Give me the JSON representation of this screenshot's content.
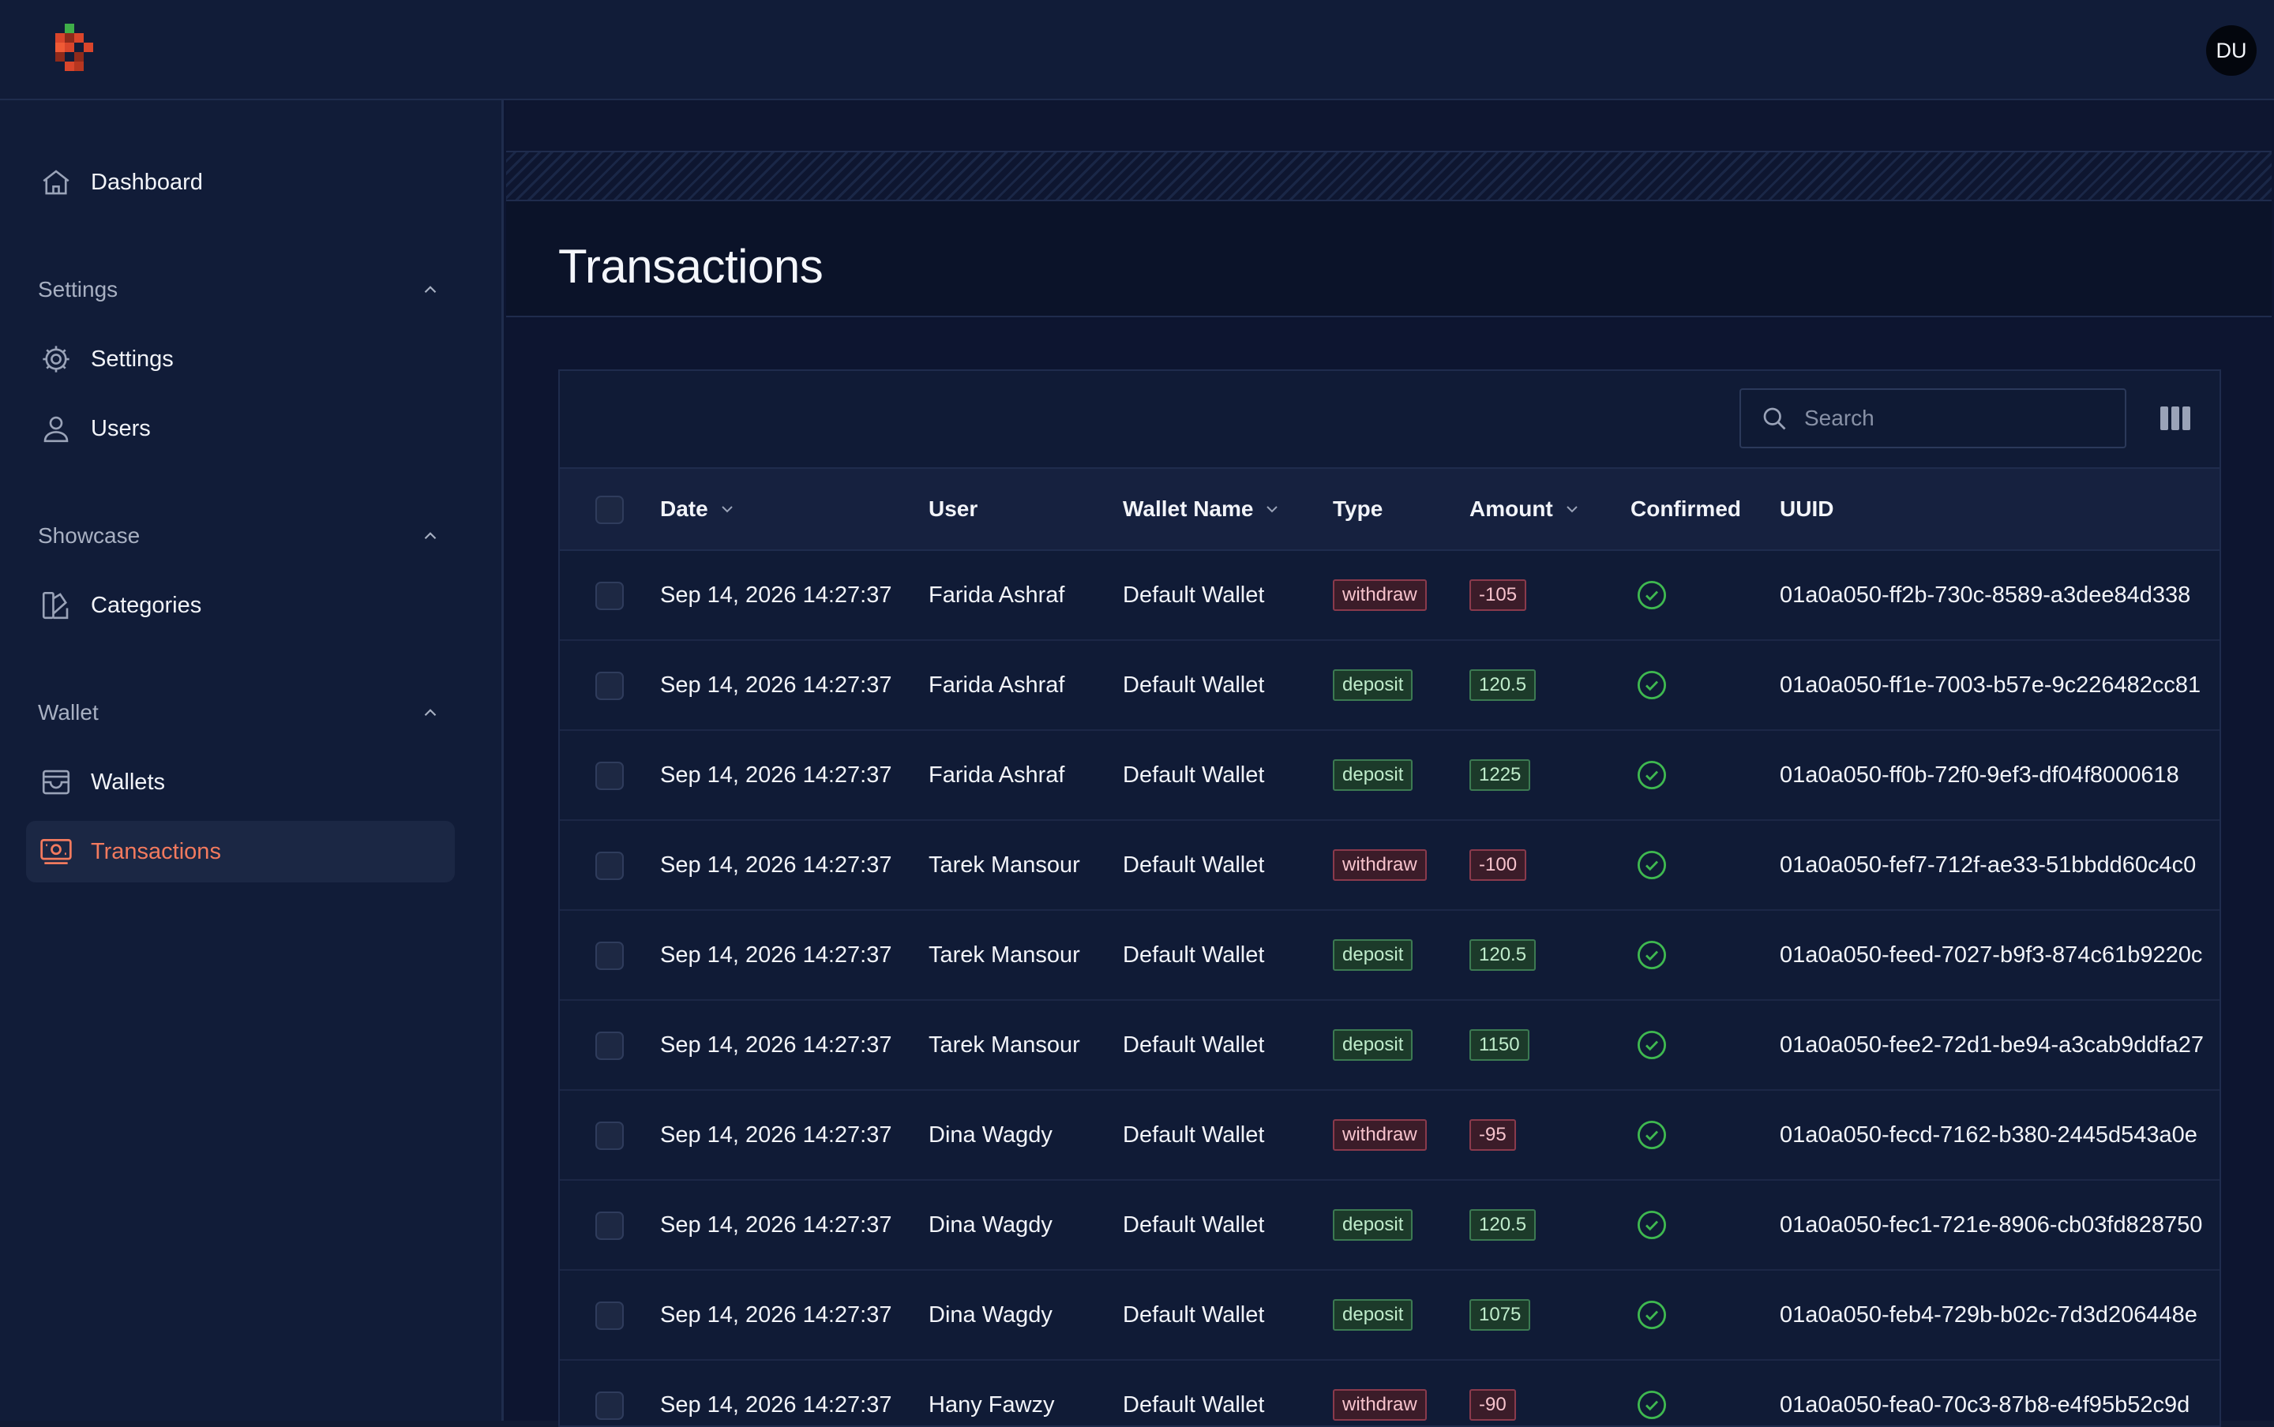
{
  "header": {
    "avatar_initials": "DU"
  },
  "sidebar": {
    "dashboard": "Dashboard",
    "sections": [
      {
        "title": "Settings",
        "items": [
          "Settings",
          "Users"
        ]
      },
      {
        "title": "Showcase",
        "items": [
          "Categories"
        ]
      },
      {
        "title": "Wallet",
        "items": [
          "Wallets",
          "Transactions"
        ]
      }
    ],
    "active_item": "Transactions"
  },
  "page": {
    "title": "Transactions"
  },
  "toolbar": {
    "search_placeholder": "Search"
  },
  "table": {
    "columns": [
      "Date",
      "User",
      "Wallet Name",
      "Type",
      "Amount",
      "Confirmed",
      "UUID"
    ],
    "sortable_columns": [
      "Date",
      "Wallet Name",
      "Amount"
    ],
    "rows": [
      {
        "date": "Sep 14, 2026 14:27:37",
        "user": "Farida Ashraf",
        "wallet": "Default Wallet",
        "type": "withdraw",
        "amount": "-105",
        "confirmed": true,
        "uuid": "01a0a050-ff2b-730c-8589-a3dee84d338"
      },
      {
        "date": "Sep 14, 2026 14:27:37",
        "user": "Farida Ashraf",
        "wallet": "Default Wallet",
        "type": "deposit",
        "amount": "120.5",
        "confirmed": true,
        "uuid": "01a0a050-ff1e-7003-b57e-9c226482cc81"
      },
      {
        "date": "Sep 14, 2026 14:27:37",
        "user": "Farida Ashraf",
        "wallet": "Default Wallet",
        "type": "deposit",
        "amount": "1225",
        "confirmed": true,
        "uuid": "01a0a050-ff0b-72f0-9ef3-df04f8000618"
      },
      {
        "date": "Sep 14, 2026 14:27:37",
        "user": "Tarek Mansour",
        "wallet": "Default Wallet",
        "type": "withdraw",
        "amount": "-100",
        "confirmed": true,
        "uuid": "01a0a050-fef7-712f-ae33-51bbdd60c4c0"
      },
      {
        "date": "Sep 14, 2026 14:27:37",
        "user": "Tarek Mansour",
        "wallet": "Default Wallet",
        "type": "deposit",
        "amount": "120.5",
        "confirmed": true,
        "uuid": "01a0a050-feed-7027-b9f3-874c61b9220c"
      },
      {
        "date": "Sep 14, 2026 14:27:37",
        "user": "Tarek Mansour",
        "wallet": "Default Wallet",
        "type": "deposit",
        "amount": "1150",
        "confirmed": true,
        "uuid": "01a0a050-fee2-72d1-be94-a3cab9ddfa27"
      },
      {
        "date": "Sep 14, 2026 14:27:37",
        "user": "Dina Wagdy",
        "wallet": "Default Wallet",
        "type": "withdraw",
        "amount": "-95",
        "confirmed": true,
        "uuid": "01a0a050-fecd-7162-b380-2445d543a0e"
      },
      {
        "date": "Sep 14, 2026 14:27:37",
        "user": "Dina Wagdy",
        "wallet": "Default Wallet",
        "type": "deposit",
        "amount": "120.5",
        "confirmed": true,
        "uuid": "01a0a050-fec1-721e-8906-cb03fd828750"
      },
      {
        "date": "Sep 14, 2026 14:27:37",
        "user": "Dina Wagdy",
        "wallet": "Default Wallet",
        "type": "deposit",
        "amount": "1075",
        "confirmed": true,
        "uuid": "01a0a050-feb4-729b-b02c-7d3d206448e"
      },
      {
        "date": "Sep 14, 2026 14:27:37",
        "user": "Hany Fawzy",
        "wallet": "Default Wallet",
        "type": "withdraw",
        "amount": "-90",
        "confirmed": true,
        "uuid": "01a0a050-fea0-70c3-87b8-e4f95b52c9d"
      }
    ]
  },
  "colors": {
    "accent": "#f27a5e",
    "confirmed_green": "#3fb950",
    "withdraw_red": "#8a3a4c",
    "deposit_green": "#3c7a52"
  },
  "icons": {
    "logo": "pixel-cross-logo",
    "dashboard": "home-icon",
    "settings": "gear-icon",
    "users": "user-icon",
    "categories": "categories-icon",
    "wallets": "wallet-icon",
    "transactions": "money-icon",
    "search": "search-icon",
    "columns": "columns-icon",
    "confirmed": "check-circle-icon"
  }
}
